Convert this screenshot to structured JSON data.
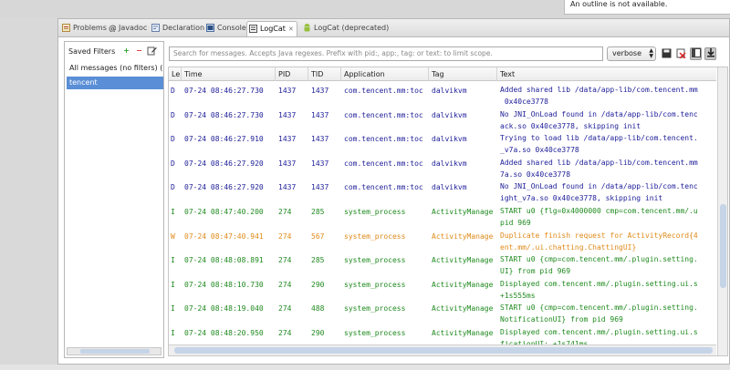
{
  "outline_message": "An outline is not available.",
  "tabs": [
    {
      "label": "Problems",
      "icon": "problems-icon"
    },
    {
      "label": "Javadoc",
      "icon": "javadoc-icon"
    },
    {
      "label": "Declaration",
      "icon": "declaration-icon"
    },
    {
      "label": "Console",
      "icon": "console-icon"
    },
    {
      "label": "LogCat",
      "icon": "logcat-icon",
      "active": true
    },
    {
      "label": "LogCat (deprecated)",
      "icon": "android-icon"
    }
  ],
  "saved_filters": {
    "title": "Saved Filters",
    "items": [
      "All messages (no filters) (",
      "tencent"
    ],
    "selected": "tencent"
  },
  "search": {
    "placeholder": "Search for messages. Accepts Java regexes. Prefix with pid:, app:, tag: or text: to limit scope."
  },
  "level_select": {
    "value": "verbose"
  },
  "columns": [
    "Le",
    "Time",
    "PID",
    "TID",
    "Application",
    "Tag",
    "Text"
  ],
  "colors": {
    "debug": "#20209a",
    "info": "#1f8a1f",
    "warn": "#e08a1a",
    "selection": "#5a8ed6"
  },
  "rows": [
    {
      "level": "D",
      "time": "07-24 08:46:27.730",
      "pid": "1437",
      "tid": "1437",
      "app": "com.tencent.mm:toc",
      "tag": "dalvikvm",
      "text1": "Added shared lib /data/app-lib/com.tencent.mm",
      "text2": " 0x40ce3778",
      "kind": "debug"
    },
    {
      "level": "D",
      "time": "07-24 08:46:27.730",
      "pid": "1437",
      "tid": "1437",
      "app": "com.tencent.mm:toc",
      "tag": "dalvikvm",
      "text1": "No JNI_OnLoad found in /data/app-lib/com.tenc",
      "text2": "ack.so 0x40ce3778, skipping init",
      "kind": "debug"
    },
    {
      "level": "D",
      "time": "07-24 08:46:27.910",
      "pid": "1437",
      "tid": "1437",
      "app": "com.tencent.mm:toc",
      "tag": "dalvikvm",
      "text1": "Trying to load lib /data/app-lib/com.tencent.",
      "text2": "_v7a.so 0x40ce3778",
      "kind": "debug"
    },
    {
      "level": "D",
      "time": "07-24 08:46:27.920",
      "pid": "1437",
      "tid": "1437",
      "app": "com.tencent.mm:toc",
      "tag": "dalvikvm",
      "text1": "Added shared lib /data/app-lib/com.tencent.mm",
      "text2": "7a.so 0x40ce3778",
      "kind": "debug"
    },
    {
      "level": "D",
      "time": "07-24 08:46:27.920",
      "pid": "1437",
      "tid": "1437",
      "app": "com.tencent.mm:toc",
      "tag": "dalvikvm",
      "text1": "No JNI_OnLoad found in /data/app-lib/com.tenc",
      "text2": "ight_v7a.so 0x40ce3778, skipping init",
      "kind": "debug"
    },
    {
      "level": "I",
      "time": "07-24 08:47:40.200",
      "pid": "274",
      "tid": "285",
      "app": "system_process",
      "tag": "ActivityManage",
      "text1": "START u0 {flg=0x4000000 cmp=com.tencent.mm/.u",
      "text2": "pid 969",
      "kind": "info"
    },
    {
      "level": "W",
      "time": "07-24 08:47:40.941",
      "pid": "274",
      "tid": "567",
      "app": "system_process",
      "tag": "ActivityManage",
      "text1": "Duplicate finish request for ActivityRecord{4",
      "text2": "ent.mm/.ui.chatting.ChattingUI}",
      "kind": "warn"
    },
    {
      "level": "I",
      "time": "07-24 08:48:08.891",
      "pid": "274",
      "tid": "285",
      "app": "system_process",
      "tag": "ActivityManage",
      "text1": "START u0 {cmp=com.tencent.mm/.plugin.setting.",
      "text2": "UI} from pid 969",
      "kind": "info"
    },
    {
      "level": "I",
      "time": "07-24 08:48:10.730",
      "pid": "274",
      "tid": "290",
      "app": "system_process",
      "tag": "ActivityManage",
      "text1": "Displayed com.tencent.mm/.plugin.setting.ui.s",
      "text2": "+1s555ms",
      "kind": "info"
    },
    {
      "level": "I",
      "time": "07-24 08:48:19.040",
      "pid": "274",
      "tid": "488",
      "app": "system_process",
      "tag": "ActivityManage",
      "text1": "START u0 {cmp=com.tencent.mm/.plugin.setting.",
      "text2": "NotificationUI} from pid 969",
      "kind": "info"
    },
    {
      "level": "I",
      "time": "07-24 08:48:20.950",
      "pid": "274",
      "tid": "290",
      "app": "system_process",
      "tag": "ActivityManage",
      "text1": "Displayed com.tencent.mm/.plugin.setting.ui.s",
      "text2": "ficationUI: +1s741ms",
      "kind": "info"
    }
  ]
}
